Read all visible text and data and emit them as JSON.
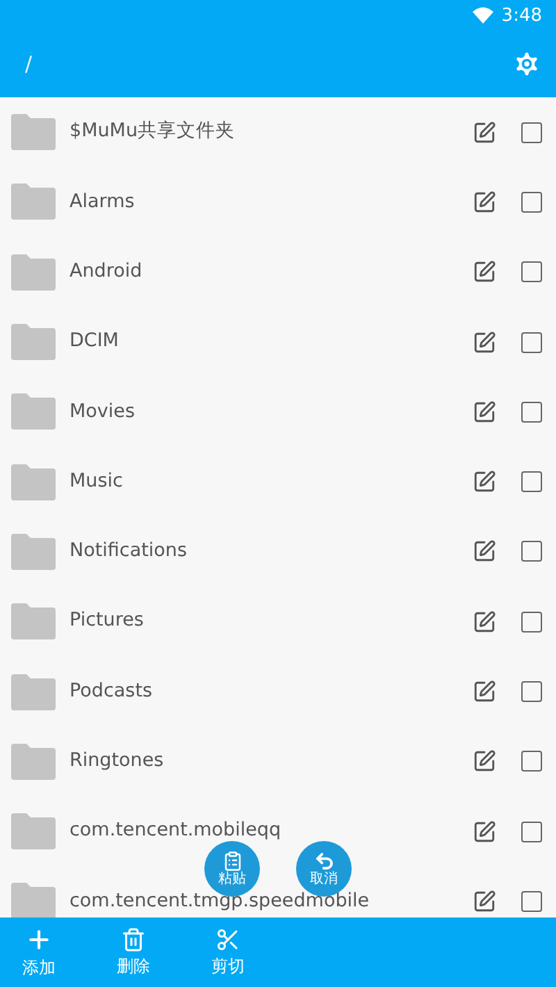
{
  "status_bar": {
    "time": "3:48"
  },
  "toolbar": {
    "path": "/"
  },
  "files": [
    {
      "name": "$MuMu共享文件夹",
      "checked": false
    },
    {
      "name": "Alarms",
      "checked": false
    },
    {
      "name": "Android",
      "checked": false
    },
    {
      "name": "DCIM",
      "checked": false
    },
    {
      "name": "Movies",
      "checked": false
    },
    {
      "name": "Music",
      "checked": false
    },
    {
      "name": "Notifications",
      "checked": false
    },
    {
      "name": "Pictures",
      "checked": false
    },
    {
      "name": "Podcasts",
      "checked": false
    },
    {
      "name": "Ringtones",
      "checked": false
    },
    {
      "name": "com.tencent.mobileqq",
      "checked": false
    },
    {
      "name": "com.tencent.tmgp.speedmobile",
      "checked": false
    }
  ],
  "floating_actions": [
    {
      "kind": "paste",
      "label": "粘贴"
    },
    {
      "kind": "cancel",
      "label": "取消"
    }
  ],
  "bottom_actions": [
    {
      "kind": "add",
      "label": "添加"
    },
    {
      "kind": "delete",
      "label": "删除"
    },
    {
      "kind": "cut",
      "label": "剪切"
    }
  ]
}
